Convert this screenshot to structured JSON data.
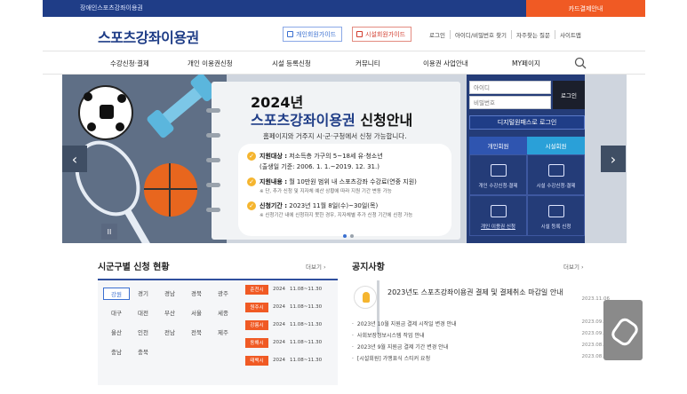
{
  "topbar": {
    "left_text": "장애인스포츠강좌이용권",
    "right_text": "카드결제안내"
  },
  "header": {
    "logo": "스포츠강좌이용권",
    "guide_personal": "개인회원가이드",
    "guide_facility": "시설회원가이드",
    "links": [
      "로그인",
      "아이디/비밀번호 찾기",
      "자주찾는 질문",
      "사이트맵"
    ]
  },
  "gnb": [
    "수강신청·결제",
    "개인 이용권신청",
    "시설 등록신청",
    "커뮤니티",
    "이용권 사업안내",
    "MY페이지"
  ],
  "banner": {
    "year": "2024년",
    "title_main": "스포츠강좌이용권",
    "title_rest": " 신청안내",
    "subtitle": "홈페이지와 거주지 시·군·구청에서 신청 가능합니다.",
    "rows": [
      {
        "label": "지원대상 :",
        "text": "저소득층 가구의 5~18세 유·청소년",
        "extra": "(출생일 기준: 2006. 1. 1.~2019. 12. 31.)"
      },
      {
        "label": "지원내용 :",
        "text": "월 10만원 범위 내 스포츠강좌 수강료(연중 지원)",
        "note": "※ 단, 추가 신청 및 지자체 예산 상황에 따라 지원 기간 변동 가능"
      },
      {
        "label": "신청기간 :",
        "text": "2023년 11월 8일(수)~30일(목)",
        "note": "※ 신청기간 내에 신청하지 못한 경우, 지자체별 추가 신청 기간에 신청 가능"
      }
    ]
  },
  "login": {
    "id_placeholder": "아이디",
    "pw_placeholder": "비밀번호",
    "login_button": "로그인",
    "digital_login": "디지털원패스로 로그인",
    "tab_personal": "개인회원",
    "tab_facility": "시설회원",
    "menu": [
      "개인 수강신청·결제",
      "시설 수강신청·결제",
      "개인 이용권 신청",
      "시설 등록 신청"
    ]
  },
  "region": {
    "title": "시군구별 신청 현황",
    "more": "더보기",
    "names": [
      "강원",
      "경기",
      "경남",
      "경북",
      "광주",
      "대구",
      "대전",
      "부산",
      "서울",
      "세종",
      "울산",
      "인천",
      "전남",
      "전북",
      "제주",
      "충남",
      "충북"
    ],
    "list": [
      {
        "tag": "춘천시",
        "year": "2024",
        "period": "11.08~11.30"
      },
      {
        "tag": "원주시",
        "year": "2024",
        "period": "11.08~11.30"
      },
      {
        "tag": "강릉시",
        "year": "2024",
        "period": "11.08~11.30"
      },
      {
        "tag": "동해시",
        "year": "2024",
        "period": "11.08~11.30"
      },
      {
        "tag": "태백시",
        "year": "2024",
        "period": "11.08~11.30"
      }
    ]
  },
  "notice": {
    "title": "공지사항",
    "more": "더보기",
    "featured": {
      "text": "2023년도 스포츠강좌이용권 결제 및 결제취소 마감일 안내",
      "date": "2023.11.06"
    },
    "items": [
      {
        "text": "2023년 10월 지원금 결제 시작일 변경 안내",
        "date": "2023.09.27"
      },
      {
        "text": "사회보장정보시스템 작업 안내",
        "date": "2023.09.22"
      },
      {
        "text": "2023년 9월 지원금 결제 기간 변경 안내",
        "date": "2023.08.28"
      },
      {
        "text": "[시설회원] 가맹표식 스티커 요청",
        "date": "2023.08.23"
      }
    ]
  }
}
